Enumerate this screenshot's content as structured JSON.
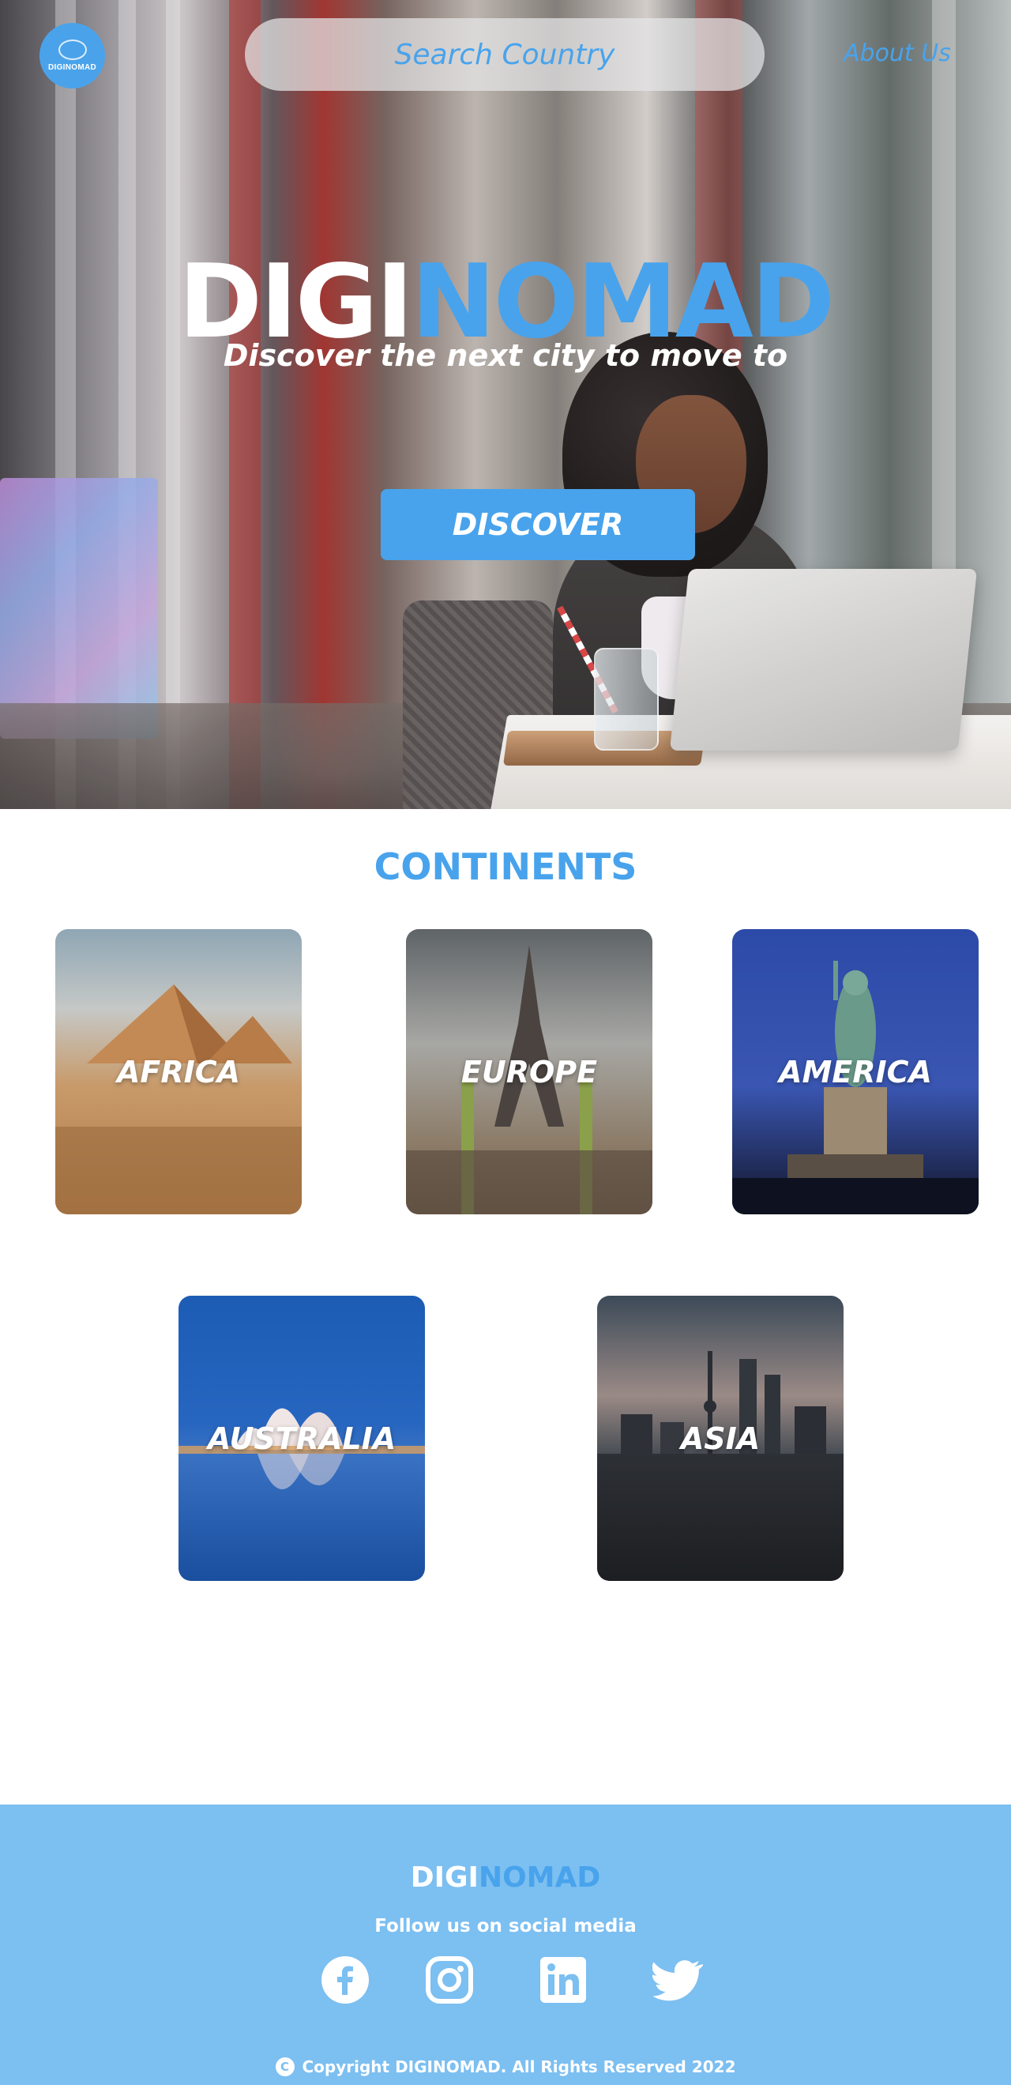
{
  "header": {
    "logo_text": "DIGINOMAD",
    "search_placeholder": "Search Country",
    "about_link": "About Us"
  },
  "hero": {
    "title_part1": "DIGI",
    "title_part2": "NOMAD",
    "subtitle": "Discover the next city to move to",
    "cta_label": "DISCOVER"
  },
  "continents": {
    "heading": "CONTINENTS",
    "items": [
      {
        "label": "AFRICA"
      },
      {
        "label": "EUROPE"
      },
      {
        "label": "AMERICA"
      },
      {
        "label": "AUSTRALIA"
      },
      {
        "label": "ASIA"
      }
    ]
  },
  "footer": {
    "brand_part1": "DIGI",
    "brand_part2": "NOMAD",
    "follow_text": "Follow us on social media",
    "social": [
      "facebook-icon",
      "instagram-icon",
      "linkedin-icon",
      "twitter-icon"
    ],
    "copyright_symbol": "C",
    "copyright_text": "Copyright DIGINOMAD. All Rights Reserved 2022"
  },
  "colors": {
    "accent": "#48a3ec",
    "footer_bg": "#7cbff1",
    "white": "#ffffff"
  }
}
